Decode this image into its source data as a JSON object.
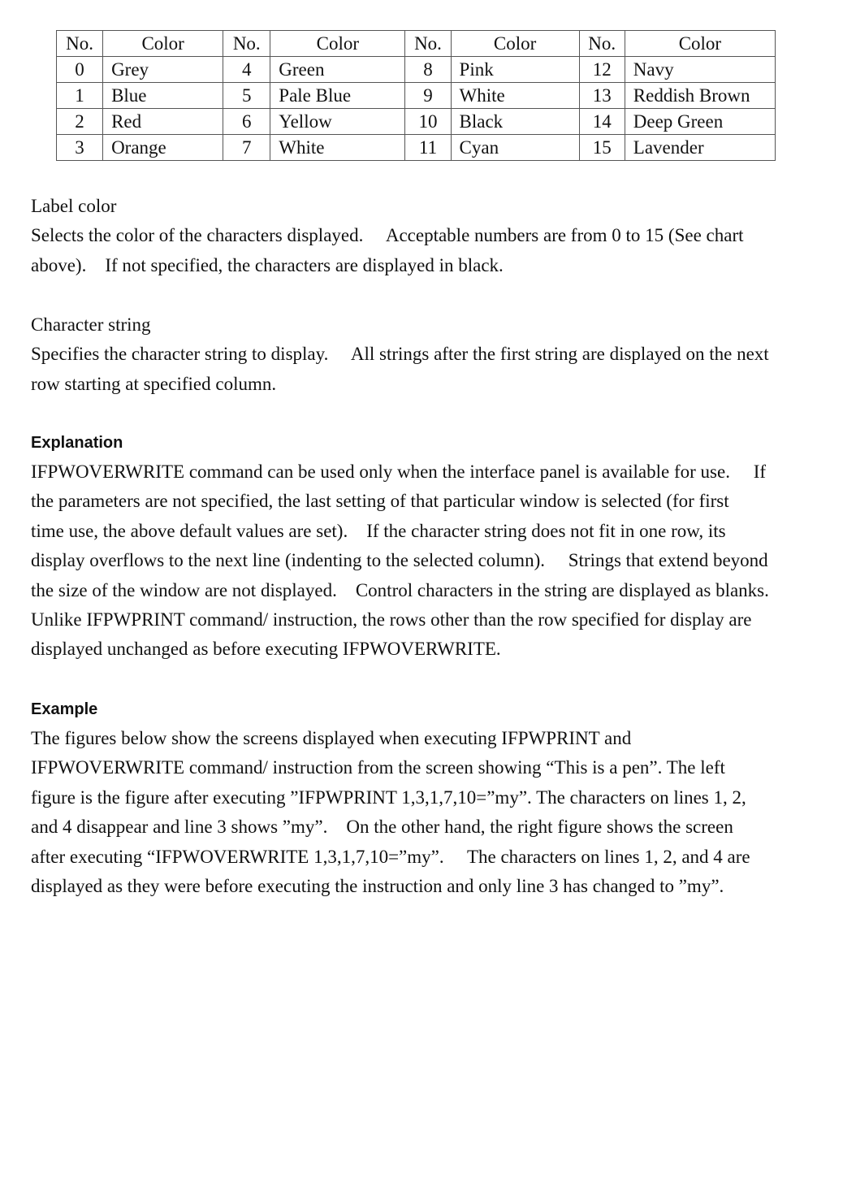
{
  "color_table": {
    "headers": [
      "No.",
      "Color",
      "No.",
      "Color",
      "No.",
      "Color",
      "No.",
      "Color"
    ],
    "rows": [
      [
        "0",
        "Grey",
        "4",
        "Green",
        "8",
        "Pink",
        "12",
        "Navy"
      ],
      [
        "1",
        "Blue",
        "5",
        "Pale Blue",
        "9",
        "White",
        "13",
        "Reddish Brown"
      ],
      [
        "2",
        "Red",
        "6",
        "Yellow",
        "10",
        "Black",
        "14",
        "Deep Green"
      ],
      [
        "3",
        "Orange",
        "7",
        "White",
        "11",
        "Cyan",
        "15",
        "Lavender"
      ]
    ]
  },
  "label_color": {
    "title": "Label color",
    "lines": [
      "Selects the color of the characters displayed.  Acceptable numbers are from 0 to 15 (See chart",
      "above). If not specified, the characters are displayed in black."
    ]
  },
  "character_string": {
    "title": "Character string",
    "lines": [
      "Specifies the character string to display.  All strings after the first string are displayed on the next",
      "row starting at specified column."
    ]
  },
  "explanation": {
    "title": "Explanation",
    "lines": [
      "IFPWOVERWRITE command can be used only when the interface panel is available for use.  If",
      "the parameters are not specified, the last setting of that particular window is selected (for first",
      "time use, the above default values are set). If the character string does not fit in one row, its",
      "display overflows to the next line (indenting to the selected column).  Strings that extend beyond",
      "the size of the window are not displayed. Control characters in the string are displayed as blanks.",
      "Unlike IFPWPRINT command/ instruction, the rows other than the row specified for display are",
      "displayed unchanged as before executing IFPWOVERWRITE."
    ]
  },
  "example": {
    "title": "Example",
    "lines": [
      "The figures below show the screens displayed when executing IFPWPRINT and",
      "IFPWOVERWRITE command/ instruction from the screen showing “This is a pen”. The left",
      "figure is the figure after executing ”IFPWPRINT 1,3,1,7,10=”my”. The characters on lines 1, 2,",
      "and 4 disappear and line 3 shows ”my”. On the other hand, the right figure shows the screen",
      "after executing “IFPWOVERWRITE 1,3,1,7,10=”my”.  The characters on lines 1, 2, and 4 are",
      "displayed as they were before executing the instruction and only line 3 has changed to ”my”."
    ]
  }
}
